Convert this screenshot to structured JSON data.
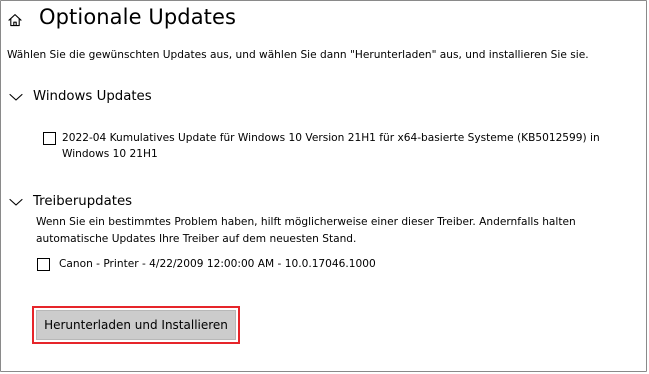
{
  "header": {
    "home_icon": "home-icon",
    "title": "Optionale Updates"
  },
  "intro": "Wählen Sie die gewünschten Updates aus, und wählen Sie dann \"Herunterladen\" aus, und installieren Sie sie.",
  "windows_updates": {
    "title": "Windows Updates",
    "expanded": true,
    "items": [
      {
        "label": "2022-04 Kumulatives Update für Windows 10 Version 21H1 für x64-basierte Systeme (KB5012599) in Windows 10 21H1",
        "checked": false
      }
    ]
  },
  "driver_updates": {
    "title": "Treiberupdates",
    "expanded": true,
    "description": "Wenn Sie ein bestimmtes Problem haben, hilft möglicherweise einer dieser Treiber. Andernfalls halten automatische Updates Ihre Treiber auf dem neuesten Stand.",
    "items": [
      {
        "label": "Canon - Printer - 4/22/2009 12:00:00 AM - 10.0.17046.1000",
        "checked": false
      }
    ]
  },
  "actions": {
    "install_label": "Herunterladen und Installieren"
  },
  "colors": {
    "highlight": "#e6252a",
    "button_bg": "#cccccc",
    "frame_border": "#8a8a8a"
  }
}
